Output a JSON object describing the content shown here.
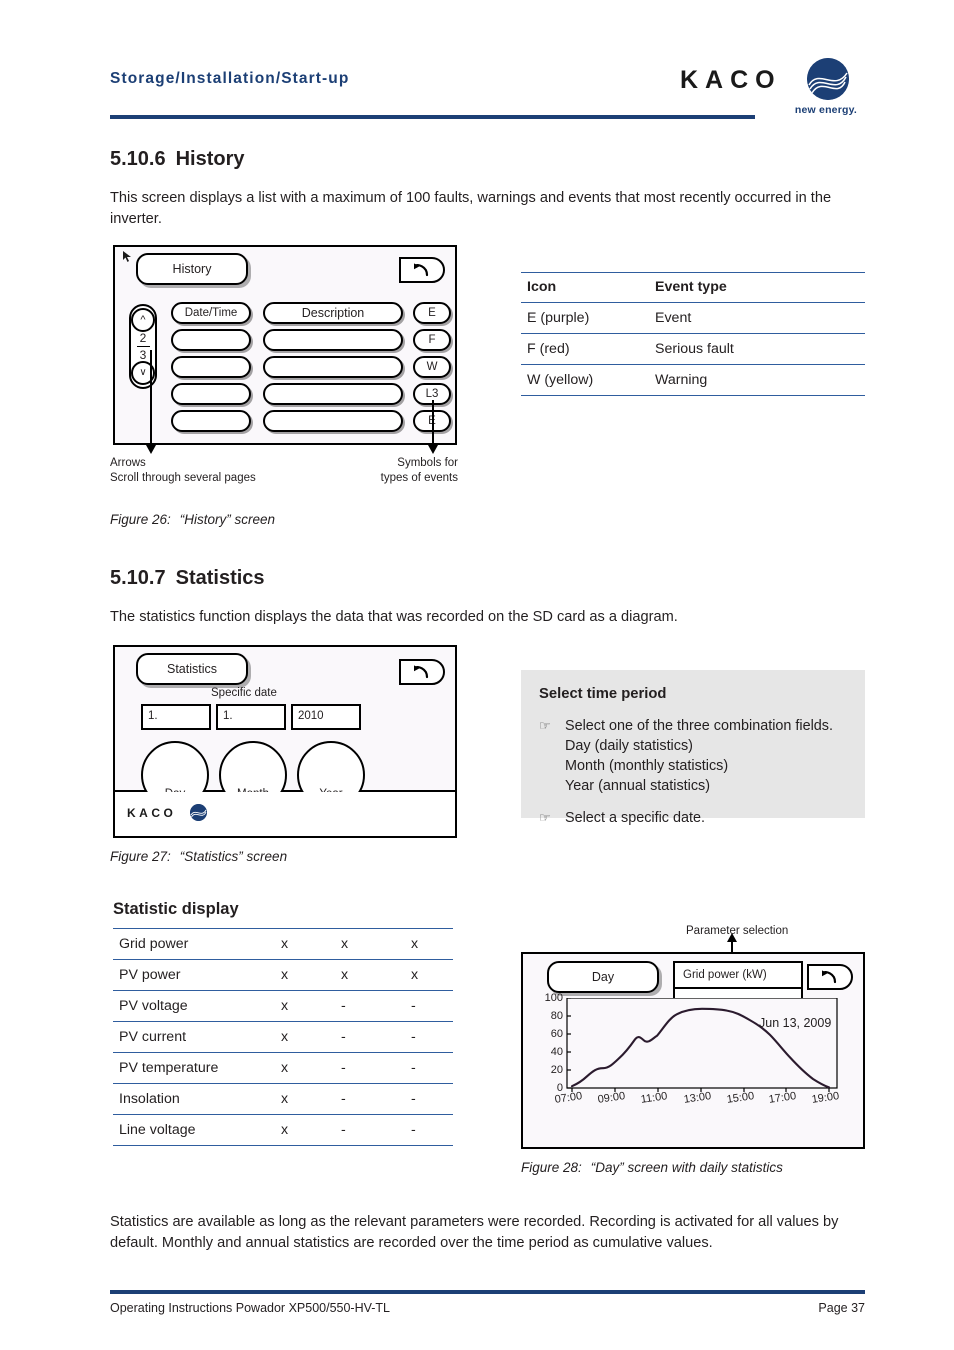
{
  "header": {
    "title": "Storage/Installation/Start-up",
    "logo_word": "KACO",
    "logo_tagline": "new energy."
  },
  "sections": {
    "history": {
      "number": "5.10.6",
      "title": "History",
      "intro": "This screen displays a list with a maximum of 100 faults, warnings and events that most recently occurred in the inverter.",
      "caption_num": "Figure 26:",
      "caption_text": "“History” screen",
      "screen": {
        "title_tab": "History",
        "col_datetime": "Date/Time",
        "col_description": "Description",
        "page_current": "2",
        "page_total": "3",
        "event_symbols": [
          "E",
          "F",
          "W",
          "L3",
          "E"
        ],
        "back_icon": "back-arrow-icon"
      },
      "annotation_left": "Arrows\nScroll through several pages",
      "annotation_left_line1": "Arrows",
      "annotation_left_line2": "Scroll through several pages",
      "annotation_right_line1": "Symbols for",
      "annotation_right_line2": "types of events"
    },
    "statistics": {
      "number": "5.10.7",
      "title": "Statistics",
      "intro": "The statistics function displays the data that was recorded on the SD card as a diagram.",
      "caption_num": "Figure 27:",
      "caption_text": "“Statistics” screen",
      "screen": {
        "title_tab": "Statistics",
        "specific_date_label": "Specific date",
        "field_day": "1.",
        "field_month": "1.",
        "field_year": "2010",
        "button_day": "Day",
        "button_month": "Month",
        "button_year": "Year",
        "brand": "KACO",
        "back_icon": "back-arrow-icon"
      }
    },
    "statistic_display": {
      "title": "Statistic display"
    },
    "day_screen": {
      "caption_num": "Figure 28:",
      "caption_text": "“Day” screen with daily statistics",
      "parameter_selection_label": "Parameter selection",
      "title_tab": "Day",
      "dropdown_value": "Grid power (kW)",
      "dropdown_empty_rows": [
        "",
        ""
      ],
      "back_icon": "back-arrow-icon"
    },
    "closing_text": "Statistics are available as long as the relevant parameters were recorded. Recording is activated for all values by default. Monthly and annual statistics are recorded over the time period as cumulative values."
  },
  "event_table": {
    "headers": [
      "Icon",
      "Event type"
    ],
    "rows": [
      [
        "E (purple)",
        "Event"
      ],
      [
        "F (red)",
        "Serious fault"
      ],
      [
        "W (yellow)",
        "Warning"
      ]
    ]
  },
  "select_time_period": {
    "title": "Select time period",
    "items": [
      "Select one of the three combination fields.\nDay (daily statistics)\nMonth (monthly statistics)\nYear (annual statistics)",
      "Select a specific date."
    ],
    "item1_lines": [
      "Select one of the three combination fields.",
      "Day (daily statistics)",
      "Month (monthly statistics)",
      "Year (annual statistics)"
    ],
    "item2_lines": [
      "Select a specific date."
    ],
    "bullet_glyph": "☞"
  },
  "statistic_table": {
    "rows": [
      {
        "label": "Grid power",
        "values": [
          "x",
          "x",
          "x"
        ]
      },
      {
        "label": "PV power",
        "values": [
          "x",
          "x",
          "x"
        ]
      },
      {
        "label": "PV voltage",
        "values": [
          "x",
          "-",
          "-"
        ]
      },
      {
        "label": "PV current",
        "values": [
          "x",
          "-",
          "-"
        ]
      },
      {
        "label": "PV temperature",
        "values": [
          "x",
          "-",
          "-"
        ]
      },
      {
        "label": "Insolation",
        "values": [
          "x",
          "-",
          "-"
        ]
      },
      {
        "label": "Line voltage",
        "values": [
          "x",
          "-",
          "-"
        ]
      }
    ]
  },
  "chart_data": {
    "type": "line",
    "title": "Grid power (kW)",
    "annotation": "Jun 13, 2009",
    "xlabel": "",
    "ylabel": "",
    "ylim": [
      0,
      100
    ],
    "yticks": [
      0,
      20,
      40,
      60,
      80,
      100
    ],
    "xticks": [
      "07:00",
      "09:00",
      "11:00",
      "13:00",
      "15:00",
      "17:00",
      "19:00"
    ],
    "grid": false,
    "legend": "none",
    "line_color": "#2b1b2e",
    "x": [
      "07:00",
      "07:30",
      "08:00",
      "08:30",
      "09:00",
      "09:30",
      "10:00",
      "10:15",
      "10:30",
      "10:45",
      "11:00",
      "11:30",
      "12:00",
      "12:30",
      "13:00",
      "13:30",
      "14:00",
      "14:30",
      "15:00",
      "15:30",
      "16:00",
      "16:30",
      "17:00",
      "17:30",
      "18:00",
      "18:30",
      "19:00"
    ],
    "values": [
      2,
      7,
      13,
      18,
      22,
      33,
      45,
      54,
      52,
      58,
      70,
      83,
      88,
      88,
      88,
      87,
      84,
      80,
      76,
      71,
      65,
      56,
      45,
      33,
      22,
      11,
      1
    ]
  },
  "footer": {
    "left": "Operating Instructions Powador XP500/550-HV-TL",
    "right": "Page 37"
  }
}
